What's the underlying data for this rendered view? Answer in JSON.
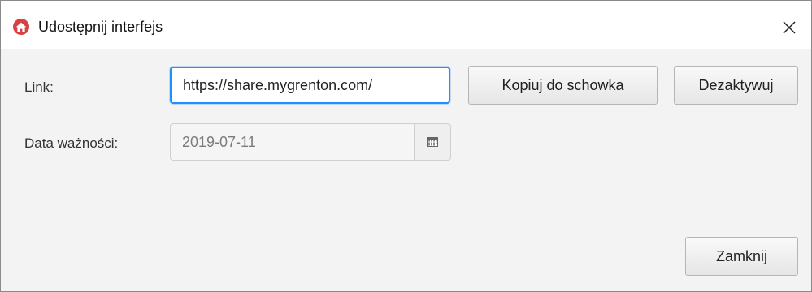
{
  "window": {
    "title": "Udostępnij interfejs",
    "close_glyph": "✕"
  },
  "link": {
    "label": "Link:",
    "value": "https://share.mygrenton.com/"
  },
  "buttons": {
    "copy": "Kopiuj do schowka",
    "deactivate": "Dezaktywuj",
    "close": "Zamknij"
  },
  "expiry": {
    "label": "Data ważności:",
    "value": "2019-07-11"
  },
  "icons": {
    "app": "grenton-home-icon",
    "calendar": "calendar-icon",
    "close": "close-icon"
  },
  "colors": {
    "app_icon": "#d94242",
    "focus": "#1e90ff",
    "background": "#f3f3f3"
  }
}
